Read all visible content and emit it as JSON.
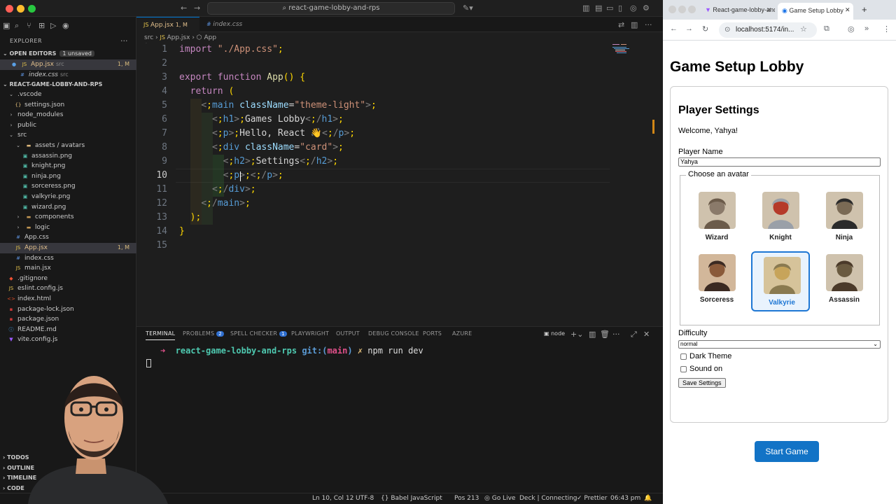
{
  "vscode": {
    "search_text": "react-game-lobby-and-rps",
    "explorer": {
      "title": "EXPLORER",
      "open_editors_label": "OPEN EDITORS",
      "unsaved_badge": "1 unsaved",
      "open_editors": [
        {
          "name": "App.jsx",
          "dir": "src",
          "meta": "1, M"
        },
        {
          "name": "index.css",
          "dir": "src",
          "meta": ""
        }
      ],
      "project_label": "REACT-GAME-LOBBY-AND-RPS",
      "tree": [
        {
          "name": ".vscode",
          "kind": "folder-open",
          "depth": 0
        },
        {
          "name": "settings.json",
          "kind": "json",
          "depth": 1
        },
        {
          "name": "node_modules",
          "kind": "folder",
          "depth": 0
        },
        {
          "name": "public",
          "kind": "folder",
          "depth": 0
        },
        {
          "name": "src",
          "kind": "folder-open",
          "depth": 0
        },
        {
          "name": "assets / avatars",
          "kind": "folder-open",
          "depth": 1
        },
        {
          "name": "assassin.png",
          "kind": "image",
          "depth": 2
        },
        {
          "name": "knight.png",
          "kind": "image",
          "depth": 2
        },
        {
          "name": "ninja.png",
          "kind": "image",
          "depth": 2
        },
        {
          "name": "sorceress.png",
          "kind": "image",
          "depth": 2
        },
        {
          "name": "valkyrie.png",
          "kind": "image",
          "depth": 2
        },
        {
          "name": "wizard.png",
          "kind": "image",
          "depth": 2
        },
        {
          "name": "components",
          "kind": "folder",
          "depth": 1
        },
        {
          "name": "logic",
          "kind": "folder",
          "depth": 1
        },
        {
          "name": "App.css",
          "kind": "css",
          "depth": 1
        },
        {
          "name": "App.jsx",
          "kind": "jsx",
          "depth": 1,
          "meta": "1, M"
        },
        {
          "name": "index.css",
          "kind": "css",
          "depth": 1
        },
        {
          "name": "main.jsx",
          "kind": "jsx",
          "depth": 1
        },
        {
          "name": ".gitignore",
          "kind": "git",
          "depth": 0
        },
        {
          "name": "eslint.config.js",
          "kind": "js",
          "depth": 0
        },
        {
          "name": "index.html",
          "kind": "html",
          "depth": 0
        },
        {
          "name": "package-lock.json",
          "kind": "npm",
          "depth": 0
        },
        {
          "name": "package.json",
          "kind": "npm",
          "depth": 0
        },
        {
          "name": "README.md",
          "kind": "md",
          "depth": 0
        },
        {
          "name": "vite.config.js",
          "kind": "vite",
          "depth": 0
        }
      ],
      "bottom_sections": [
        "TODOS",
        "OUTLINE",
        "TIMELINE",
        "CODE"
      ]
    },
    "tabs": [
      {
        "label": "App.jsx",
        "meta": "1, M",
        "active": true
      },
      {
        "label": "index.css",
        "meta": "",
        "active": false
      }
    ],
    "breadcrumb": [
      "src",
      "App.jsx",
      "App"
    ],
    "line_numbers": [
      "1",
      "2",
      "3",
      "4",
      "5",
      "6",
      "7",
      "8",
      "9",
      "10",
      "11",
      "12",
      "13",
      "14",
      "15"
    ],
    "code_lines": [
      "import \"./App.css\";",
      "",
      "export function App() {",
      "  return (",
      "    <main className=\"theme-light\">",
      "      <h1>Games Lobby</h1>",
      "      <p>Hello, React 👋</p>",
      "      <div className=\"card\">",
      "        <h2>Settings</h2>",
      "        <p></p>",
      "      </div>",
      "    </main>",
      "  );",
      "}",
      ""
    ],
    "panel_tabs": [
      {
        "label": "TERMINAL",
        "badge": ""
      },
      {
        "label": "PROBLEMS",
        "badge": "2"
      },
      {
        "label": "SPELL CHECKER",
        "badge": "1"
      },
      {
        "label": "PLAYWRIGHT",
        "badge": ""
      },
      {
        "label": "OUTPUT",
        "badge": ""
      },
      {
        "label": "DEBUG CONSOLE",
        "badge": ""
      },
      {
        "label": "PORTS",
        "badge": ""
      },
      {
        "label": "AZURE",
        "badge": ""
      }
    ],
    "terminal_shell": "node",
    "terminal": {
      "arrow": "➜",
      "dir": "react-game-lobby-and-rps",
      "git_prefix": "git:(",
      "branch": "main",
      "git_suffix": ")",
      "dirty": "✗",
      "command": "npm run dev"
    },
    "status": {
      "position": "Ln 10, Col 12",
      "encoding": "UTF-8",
      "language": "Babel JavaScript",
      "pos": "Pos 213",
      "golive": "Go Live",
      "deck": "Deck | Connecting",
      "prettier": "Prettier",
      "time": "06:43 pm"
    }
  },
  "browser": {
    "tabs": [
      {
        "label": "React-game-lobby-and-rps",
        "active": false
      },
      {
        "label": "Game Setup Lobby",
        "active": true
      }
    ],
    "url": "localhost:5174/in...",
    "page": {
      "title": "Game Setup Lobby",
      "card_title": "Player Settings",
      "welcome": "Welcome, Yahya!",
      "name_label": "Player Name",
      "name_value": "Yahya",
      "avatar_legend": "Choose an avatar",
      "avatars": [
        {
          "name": "Wizard",
          "selected": false
        },
        {
          "name": "Knight",
          "selected": false
        },
        {
          "name": "Ninja",
          "selected": false
        },
        {
          "name": "Sorceress",
          "selected": false
        },
        {
          "name": "Valkyrie",
          "selected": true
        },
        {
          "name": "Assassin",
          "selected": false
        }
      ],
      "difficulty_label": "Difficulty",
      "difficulty_value": "normal",
      "dark_theme_label": "Dark Theme",
      "sound_label": "Sound on",
      "save_label": "Save Settings",
      "start_label": "Start Game"
    }
  },
  "colors": {
    "selected_accent": "#1e77d4",
    "start_button": "#1273c6",
    "vscode_bg": "#1e1e1e"
  }
}
